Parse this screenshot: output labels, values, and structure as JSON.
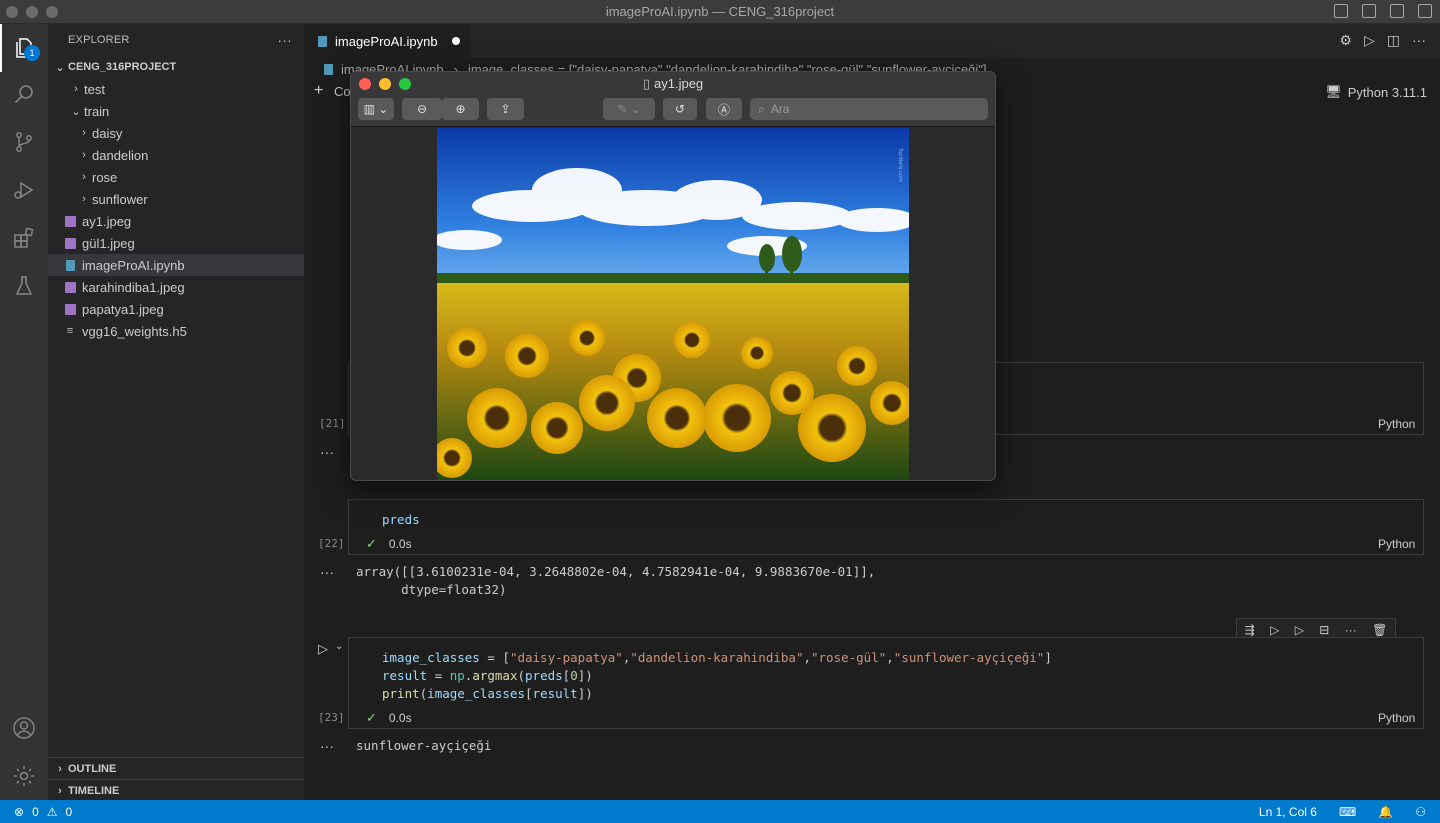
{
  "window": {
    "title": "imageProAI.ipynb — CENG_316project"
  },
  "activity_bar": {
    "explorer_badge": "1"
  },
  "explorer": {
    "header": "EXPLORER",
    "more": "···",
    "project": "CENG_316PROJECT",
    "items": [
      {
        "label": "test",
        "type": "folder"
      },
      {
        "label": "train",
        "type": "folder-open"
      },
      {
        "label": "daisy",
        "type": "folder"
      },
      {
        "label": "dandelion",
        "type": "folder"
      },
      {
        "label": "rose",
        "type": "folder"
      },
      {
        "label": "sunflower",
        "type": "folder"
      },
      {
        "label": "ay1.jpeg",
        "type": "image"
      },
      {
        "label": "gül1.jpeg",
        "type": "image"
      },
      {
        "label": "imageProAI.ipynb",
        "type": "notebook"
      },
      {
        "label": "karahindiba1.jpeg",
        "type": "image"
      },
      {
        "label": "papatya1.jpeg",
        "type": "image"
      },
      {
        "label": "vgg16_weights.h5",
        "type": "file"
      }
    ],
    "outline": "OUTLINE",
    "timeline": "TIMELINE"
  },
  "editor": {
    "tab_label": "imageProAI.ipynb",
    "breadcrumb_file": "imageProAI.ipynb",
    "breadcrumb_symbol": "image_classes = [\"daisy-papatya\",\"dandelion-karahindiba\",\"rose-gül\",\"sunflower-ayçiçeği\"]",
    "add_code_label": "Co",
    "kernel": "Python 3.11.1"
  },
  "cells": {
    "c21": {
      "count": "[21]",
      "lang": "Python"
    },
    "c22": {
      "count": "[22]",
      "code": "preds",
      "time": "0.0s",
      "lang": "Python",
      "output_line1": "array([[3.6100231e-04, 3.2648802e-04, 4.7582941e-04, 9.9883670e-01]],",
      "output_line2": "      dtype=float32)"
    },
    "c23": {
      "count": "[23]",
      "time": "0.0s",
      "lang": "Python",
      "output": "sunflower-ayçiçeği"
    }
  },
  "preview": {
    "title": "ay1.jpeg",
    "search_placeholder": "Ara",
    "watermark": "TopWalls.com"
  },
  "statusbar": {
    "errors": "0",
    "warnings": "0",
    "position": "Ln 1, Col 6"
  },
  "colors": {
    "accent": "#007acc",
    "statusbar": "#007acc",
    "close": "#ff5f57",
    "minimize": "#febc2e",
    "maximize": "#28c840"
  }
}
